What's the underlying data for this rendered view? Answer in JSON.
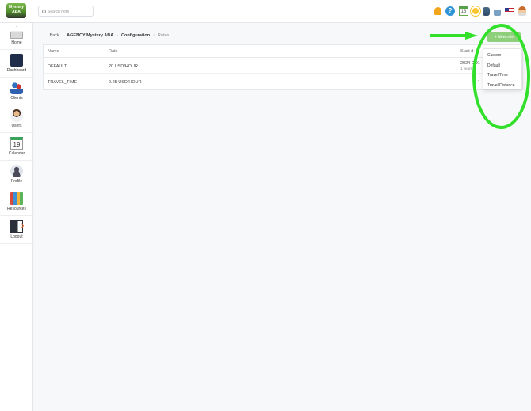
{
  "header": {
    "logo_text": "Mystery ABA",
    "search_placeholder": "Search here",
    "icons": [
      "bell-icon",
      "help-icon",
      "calendar-icon",
      "sun-icon",
      "database-icon",
      "lock-icon",
      "us-flag-icon",
      "user-avatar-icon"
    ],
    "calendar_day": "13"
  },
  "sidebar": {
    "items": [
      {
        "label": "Home",
        "icon": "home-icon"
      },
      {
        "label": "Dashboard",
        "icon": "dashboard-icon"
      },
      {
        "label": "Clients",
        "icon": "clients-icon"
      },
      {
        "label": "Users",
        "icon": "users-icon"
      },
      {
        "label": "Calendar",
        "icon": "calendar-icon",
        "day": "19"
      },
      {
        "label": "Profile",
        "icon": "profile-icon"
      },
      {
        "label": "Resources",
        "icon": "resources-icon"
      },
      {
        "label": "Logout",
        "icon": "logout-icon"
      }
    ]
  },
  "breadcrumb": {
    "back": "Back",
    "agency": "AGENCY Mystery ABA",
    "configuration": "Configuration",
    "current": "Rates"
  },
  "toolbar": {
    "new_rate": "+ New rate"
  },
  "dropdown": {
    "items": [
      "Custom",
      "Default",
      "Travel Time",
      "Travel Distance"
    ]
  },
  "table": {
    "columns": [
      "Name",
      "Rate",
      "Start d"
    ],
    "rows": [
      {
        "name": "DEFAULT",
        "rate": "20 USD/HOUR",
        "start": "2024-0  01",
        "start_sub": "1 years"
      },
      {
        "name": "TRAVEL_TIME",
        "rate": "0.25 USD/HOUR",
        "start": "-",
        "start_sub": ""
      }
    ]
  },
  "colors": {
    "accent_green": "#8dcf7a",
    "annotation_green": "#32e02b"
  }
}
